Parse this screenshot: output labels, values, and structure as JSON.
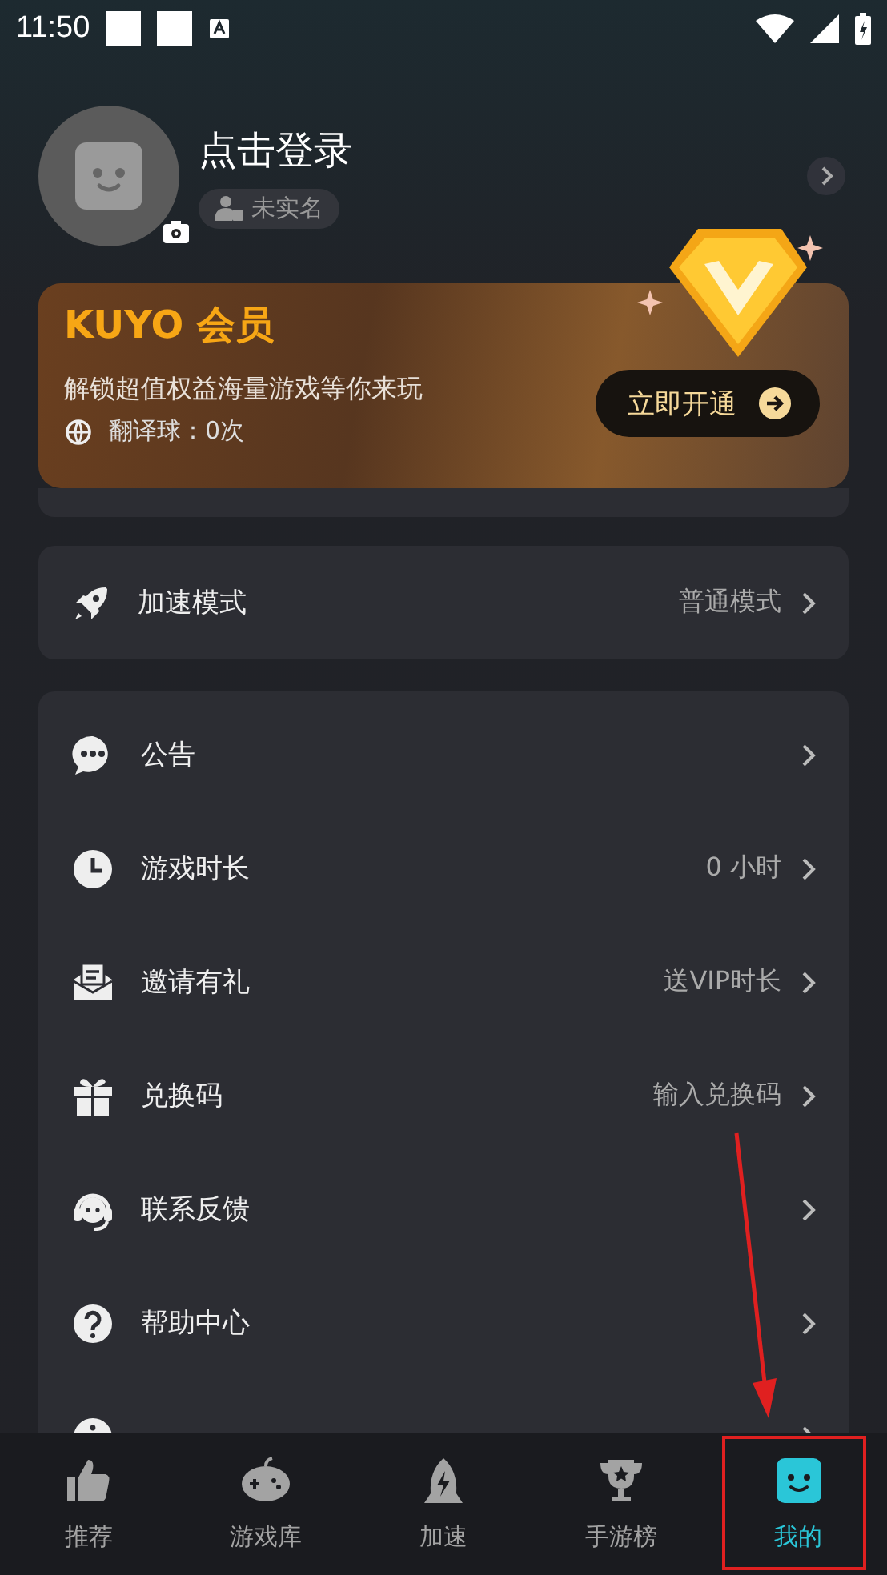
{
  "status_bar": {
    "time": "11:50"
  },
  "profile": {
    "name": "点击登录",
    "badge": "未实名"
  },
  "vip": {
    "title": "KUYO 会员",
    "subtitle": "解锁超值权益海量游戏等你来玩",
    "balls": "翻译球：0次",
    "button": "立即开通"
  },
  "mode": {
    "kind": "rocket",
    "label": "加速模式",
    "value": "普通模式"
  },
  "menu": [
    {
      "kind": "chat",
      "label": "公告"
    },
    {
      "kind": "clock",
      "label": "游戏时长",
      "value": "0 小时"
    },
    {
      "kind": "mail",
      "label": "邀请有礼",
      "value": "送VIP时长"
    },
    {
      "kind": "gift",
      "label": "兑换码",
      "value": "输入兑换码"
    },
    {
      "kind": "headset",
      "label": "联系反馈"
    },
    {
      "kind": "help",
      "label": "帮助中心"
    },
    {
      "kind": "info"
    }
  ],
  "nav": [
    {
      "kind": "thumb",
      "label": "推荐",
      "selected": false
    },
    {
      "kind": "gamepad",
      "label": "游戏库",
      "selected": false
    },
    {
      "kind": "rocket",
      "label": "加速",
      "selected": false
    },
    {
      "kind": "trophy",
      "label": "手游榜",
      "selected": false
    },
    {
      "kind": "face",
      "label": "我的",
      "selected": true
    }
  ]
}
